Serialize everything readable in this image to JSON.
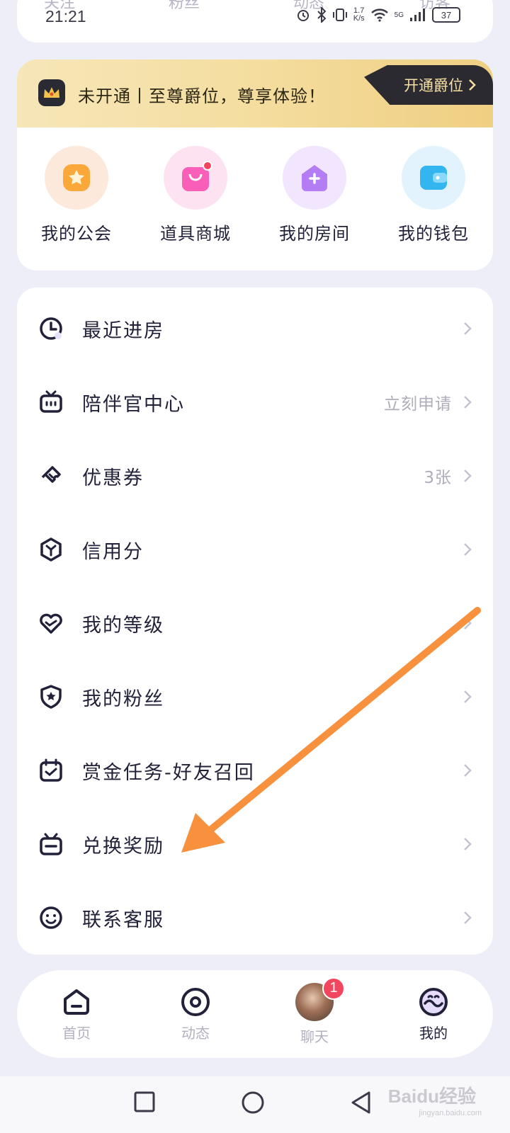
{
  "status_bar": {
    "time": "21:21",
    "net_speed_value": "1.7",
    "net_speed_unit": "K/s",
    "network": "5G",
    "battery": "37"
  },
  "top_tabs_peek": [
    "关注",
    "粉丝",
    "动态",
    "访客"
  ],
  "vip": {
    "text": "未开通丨至尊爵位，尊享体验！",
    "button": "开通爵位"
  },
  "quick_actions": [
    {
      "label": "我的公会",
      "icon": "guild-star-icon",
      "bg": "#fde9dc",
      "color": "#fba83a"
    },
    {
      "label": "道具商城",
      "icon": "shop-bag-icon",
      "bg": "#fde3f2",
      "color": "#f95fb8"
    },
    {
      "label": "我的房间",
      "icon": "room-house-icon",
      "bg": "#f1e6fd",
      "color": "#b47df3"
    },
    {
      "label": "我的钱包",
      "icon": "wallet-icon",
      "bg": "#e2f3fd",
      "color": "#33b6f0"
    }
  ],
  "menu": [
    {
      "label": "最近进房",
      "icon": "clock-icon",
      "right": ""
    },
    {
      "label": "陪伴官中心",
      "icon": "tv-icon",
      "right": "立刻申请"
    },
    {
      "label": "优惠券",
      "icon": "ticket-icon",
      "right": "3张"
    },
    {
      "label": "信用分",
      "icon": "cube-icon",
      "right": ""
    },
    {
      "label": "我的等级",
      "icon": "heart-level-icon",
      "right": ""
    },
    {
      "label": "我的粉丝",
      "icon": "shield-star-icon",
      "right": ""
    },
    {
      "label": "赏金任务-好友召回",
      "icon": "calendar-check-icon",
      "right": ""
    },
    {
      "label": "兑换奖励",
      "icon": "gift-box-icon",
      "right": ""
    },
    {
      "label": "联系客服",
      "icon": "smile-service-icon",
      "right": ""
    }
  ],
  "bottom_nav": [
    {
      "label": "首页",
      "icon": "home-icon",
      "active": false
    },
    {
      "label": "动态",
      "icon": "target-icon",
      "active": false
    },
    {
      "label": "聊天",
      "icon": "avatar-chat",
      "active": false,
      "badge": "1"
    },
    {
      "label": "我的",
      "icon": "profile-face-icon",
      "active": true
    }
  ],
  "watermark": {
    "main": "Baidu经验",
    "sub": "jingyan.baidu.com"
  },
  "colors": {
    "accent": "#22213a",
    "arrow": "#f7913d",
    "badge": "#f2465f"
  }
}
